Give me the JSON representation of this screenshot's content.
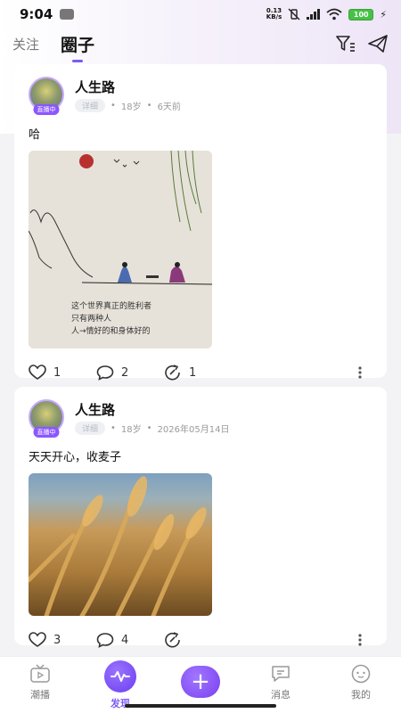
{
  "status_bar": {
    "time": "9:04",
    "net_speed_value": "0.13",
    "net_speed_unit": "KB/s",
    "battery": "100"
  },
  "header": {
    "tabs": [
      {
        "label": "关注",
        "active": false
      },
      {
        "label": "圈子",
        "active": true
      }
    ],
    "icons": [
      "filter-icon",
      "send-icon"
    ]
  },
  "posts": [
    {
      "username": "人生路",
      "live_badge": "直播中",
      "tag": "详细",
      "age": "18岁",
      "time": "6天前",
      "text": "哈",
      "image_caption_lines": [
        "这个世界真正的胜利者",
        "只有两种人",
        "人→情好的和身体好的"
      ],
      "likes": "1",
      "comments": "2",
      "shares": "1"
    },
    {
      "username": "人生路",
      "live_badge": "直播中",
      "tag": "详细",
      "age": "18岁",
      "time": "2026年05月14日",
      "text": "天天开心，收麦子",
      "likes": "3",
      "comments": "4",
      "shares": ""
    }
  ],
  "bottom_nav": {
    "items": [
      {
        "label": "潮播",
        "icon": "tv-icon",
        "active": false
      },
      {
        "label": "发现",
        "icon": "pulse-icon",
        "active": true
      },
      {
        "label": "",
        "icon": "plus-icon",
        "active": false
      },
      {
        "label": "消息",
        "icon": "chat-icon",
        "active": false
      },
      {
        "label": "我的",
        "icon": "profile-icon",
        "active": false
      }
    ]
  },
  "colors": {
    "accent": "#7b5cf0",
    "live_badge": "#8b57ff"
  }
}
